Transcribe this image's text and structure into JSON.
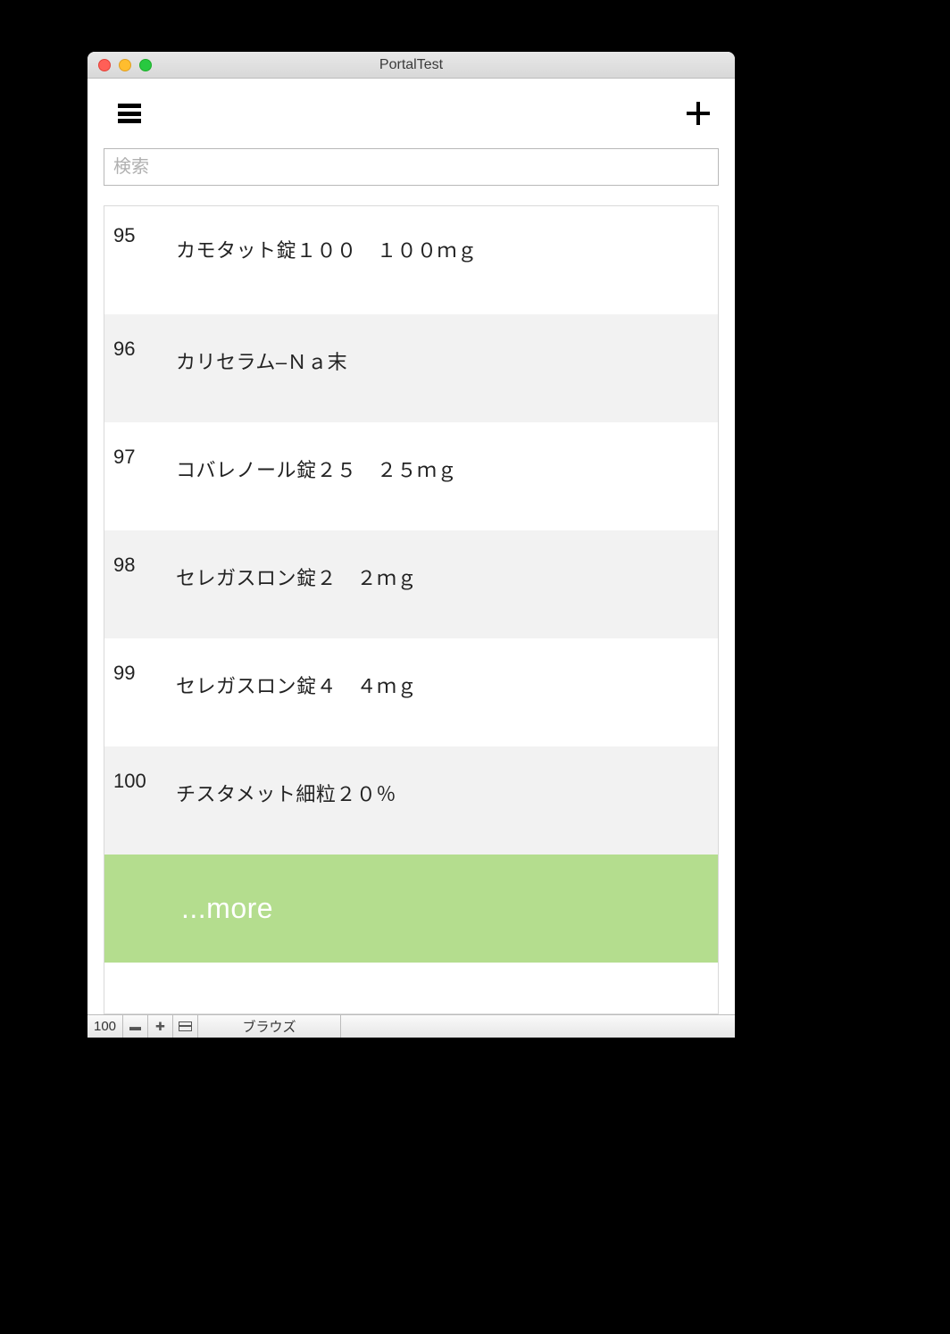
{
  "window": {
    "title": "PortalTest"
  },
  "toolbar": {
    "menu_icon": "hamburger-icon",
    "add_icon": "plus-icon"
  },
  "search": {
    "placeholder": "検索",
    "value": ""
  },
  "list": {
    "rows": [
      {
        "index": "95",
        "name": "カモタット錠１００　１００ｍｇ"
      },
      {
        "index": "96",
        "name": "カリセラム–Ｎａ末"
      },
      {
        "index": "97",
        "name": "コバレノール錠２５　２５ｍｇ"
      },
      {
        "index": "98",
        "name": "セレガスロン錠２　２ｍｇ"
      },
      {
        "index": "99",
        "name": "セレガスロン錠４　４ｍｇ"
      },
      {
        "index": "100",
        "name": "チスタメット細粒２０％"
      }
    ],
    "more_label": "...more"
  },
  "statusbar": {
    "record_count": "100",
    "mode": "ブラウズ"
  }
}
